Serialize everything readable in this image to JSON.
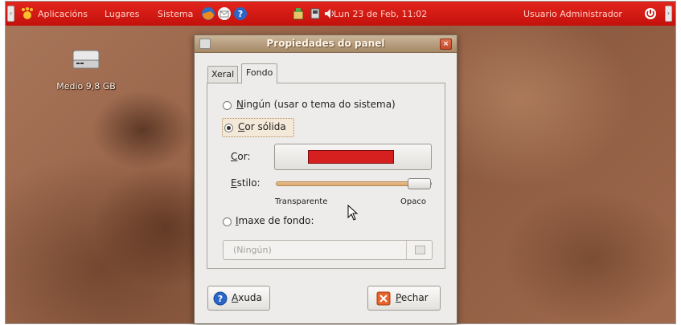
{
  "top_panel": {
    "menu_applications": "Aplicacións",
    "menu_places": "Lugares",
    "menu_system": "Sistema",
    "clock": "Lun 23 de Feb, 11:02",
    "user": "Usuario Administrador",
    "icons": [
      "foot-icon",
      "firefox-icon",
      "mail-icon",
      "help-icon",
      "update-icon",
      "network-icon",
      "volume-icon",
      "power-icon"
    ],
    "color": "#d21a14"
  },
  "desktop": {
    "drive_label": "Medio 9,8 GB"
  },
  "dialog": {
    "title": "Propiedades do panel",
    "tabs": [
      {
        "label": "Xeral",
        "selected": false
      },
      {
        "label": "Fondo",
        "selected": true
      }
    ],
    "options": {
      "none_label_rest": "ingún (usar o tema do sistema)",
      "none_mnemonic": "N",
      "none_selected": false,
      "solid_mnemonic": "C",
      "solid_label_rest": "or sólida",
      "solid_selected": true,
      "image_mnemonic": "I",
      "image_label_rest": "maxe de fondo:",
      "image_selected": false
    },
    "color_field": {
      "label_mnemonic": "C",
      "label_rest": "or:",
      "value": "#d62020"
    },
    "style_field": {
      "label_mnemonic": "E",
      "label_rest": "stilo:",
      "min_label": "Transparente",
      "max_label": "Opaco",
      "value_fraction": 1.0
    },
    "image_field": {
      "value": "(Ningún)"
    },
    "buttons": {
      "help_mnemonic": "A",
      "help_rest": "xuda",
      "close_mnemonic": "P",
      "close_rest": "echar"
    }
  }
}
